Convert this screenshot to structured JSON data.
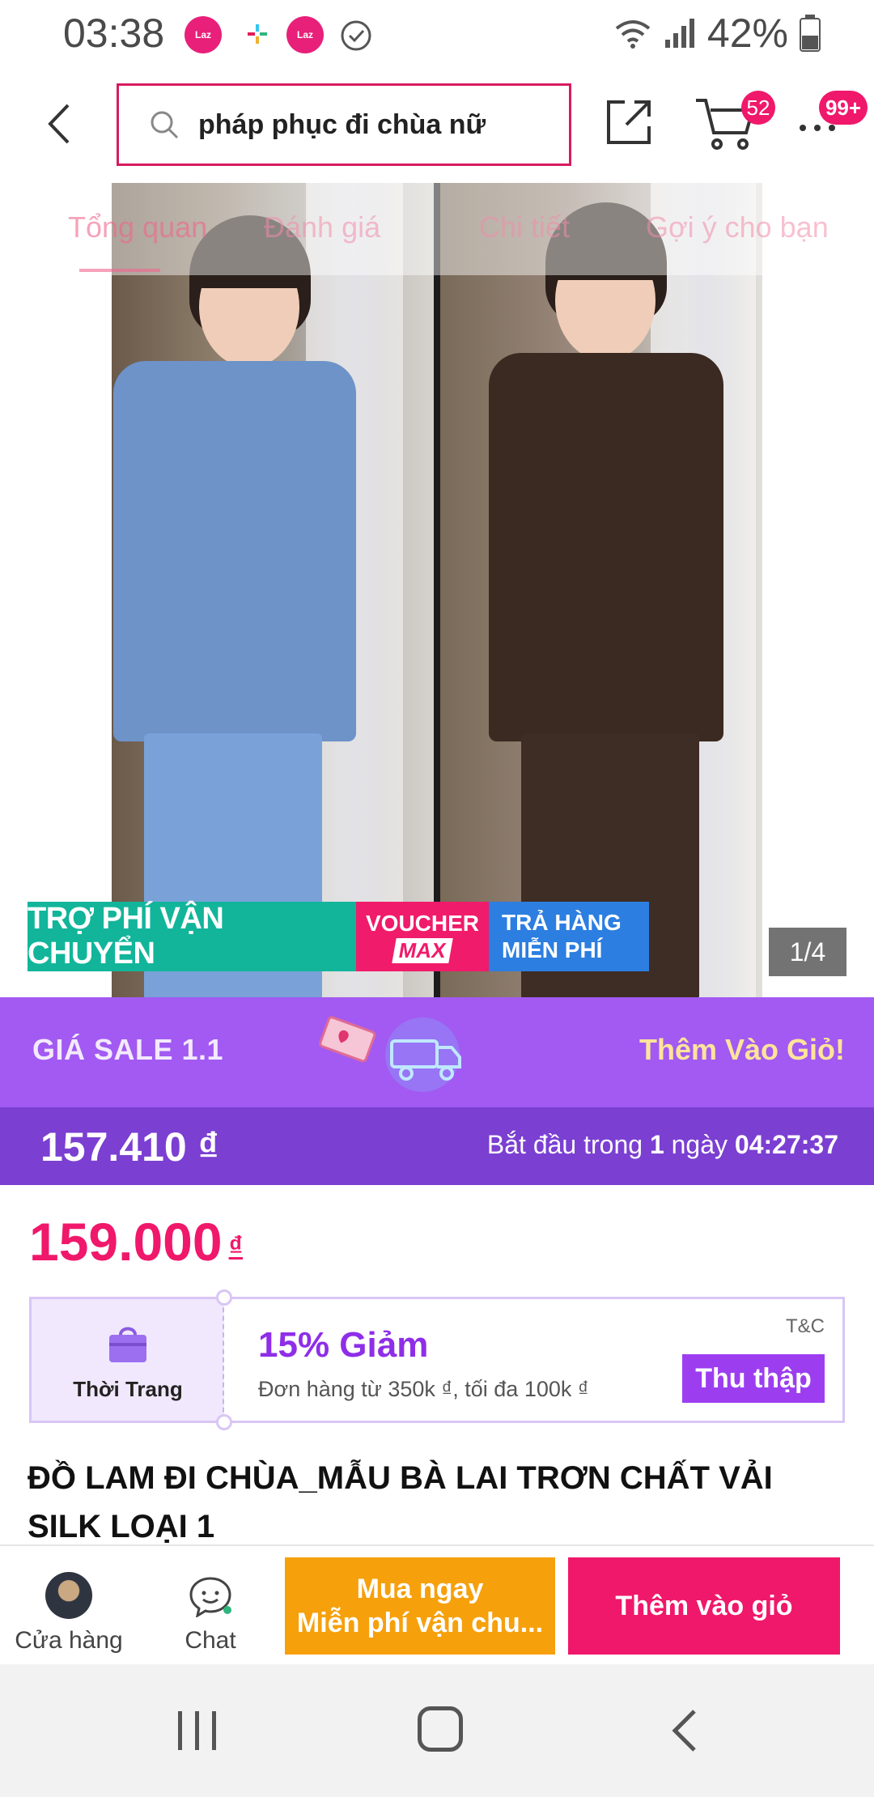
{
  "status_bar": {
    "time": "03:38",
    "app_icon_label": "Laz",
    "battery": "42%",
    "icons": [
      "lazada-app-icon",
      "slack-icon",
      "lazada-app-icon",
      "check-circle-icon",
      "wifi-icon",
      "signal-icon",
      "battery-icon"
    ]
  },
  "header": {
    "search_query": "pháp phục đi chùa nữ",
    "cart_count": "52",
    "more_count": "99+"
  },
  "tabs": [
    "Tổng quan",
    "Đánh giá",
    "Chi tiết",
    "Gợi ý cho bạn"
  ],
  "gallery": {
    "promo_shipping": "TRỢ PHÍ VẬN CHUYỂN",
    "promo_voucher_line1": "VOUCHER",
    "promo_voucher_line2": "MAX",
    "promo_return_line1": "TRẢ HÀNG",
    "promo_return_line2": "MIỄN PHÍ",
    "page_indicator": "1/4"
  },
  "flash_sale": {
    "title": "GIÁ SALE 1.1",
    "add_to_cart": "Thêm Vào Giỏ!",
    "sale_price": "157.410 ₫",
    "start_prefix": "Bắt đầu trong",
    "start_days": "1",
    "start_unit": "ngày",
    "start_time": "04:27:37"
  },
  "price": {
    "value": "159.000",
    "currency": "₫"
  },
  "voucher": {
    "category": "Thời Trang",
    "title": "15% Giảm",
    "description": "Đơn hàng từ 350k ₫, tối đa 100k ₫",
    "tc": "T&C",
    "collect": "Thu thập"
  },
  "product": {
    "title": "ĐỒ LAM ĐI CHÙA_MẪU BÀ LAI TRƠN CHẤT VẢI SILK LOẠI 1"
  },
  "action_bar": {
    "store": "Cửa hàng",
    "chat": "Chat",
    "buy_now_line1": "Mua ngay",
    "buy_now_line2": "Miễn phí vận chu...",
    "add_to_cart": "Thêm vào giỏ"
  },
  "colors": {
    "brand_pink": "#f0186b",
    "sale_purple": "#a25af2",
    "sale_dark_purple": "#7b3fd2",
    "buy_orange": "#f6a00c",
    "shipping_teal": "#12b59a",
    "return_blue": "#2c7ee0"
  }
}
